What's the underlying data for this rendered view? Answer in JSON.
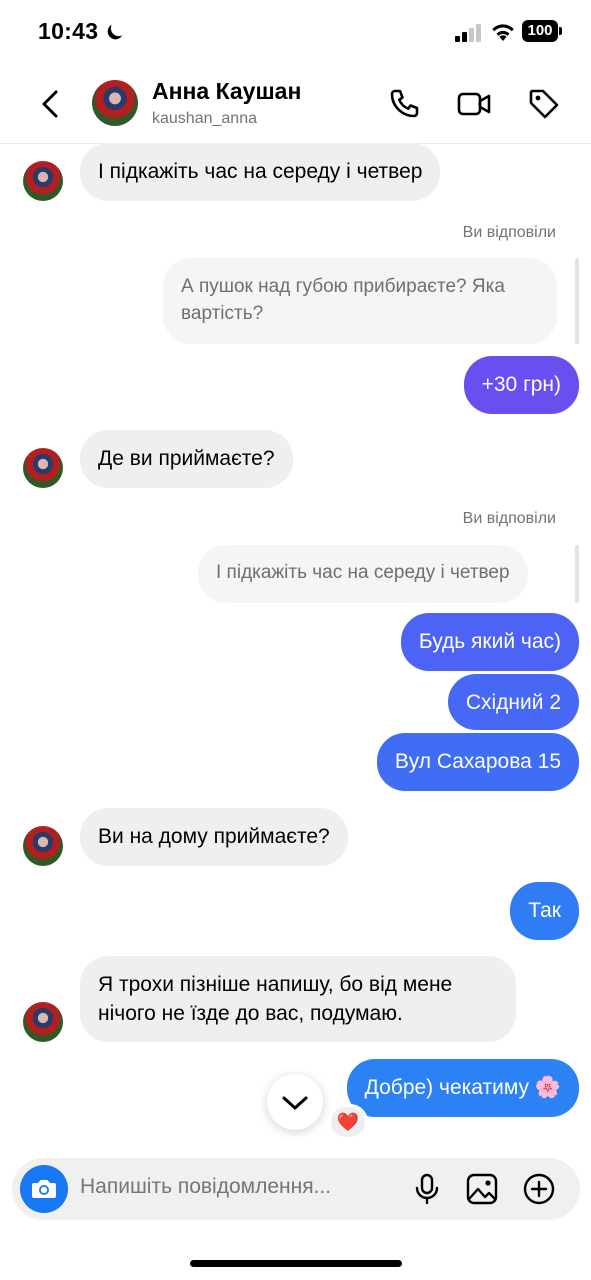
{
  "status_bar": {
    "time": "10:43",
    "battery": "100"
  },
  "header": {
    "name": "Анна Каушан",
    "username": "kaushan_anna"
  },
  "labels": {
    "replied": "Ви відповіли"
  },
  "messages": [
    {
      "text": "І підкажіть час на середу і четвер"
    },
    {
      "reply_quote": "А пушок над губою прибираєте? Яка вартість?"
    },
    {
      "text": "+30 грн)"
    },
    {
      "text": "Де ви приймаєте?"
    },
    {
      "reply_quote": "І підкажіть час на середу і четвер"
    },
    {
      "text": "Будь який час)"
    },
    {
      "text": "Східний 2"
    },
    {
      "text": "Вул Сахарова 15"
    },
    {
      "text": "Ви на дому приймаєте?"
    },
    {
      "text": "Так"
    },
    {
      "text": "Я трохи пізніше напишу, бо від мене нічого не їзде до вас, подумаю."
    },
    {
      "text": "Добре) чекатиму 🌸"
    }
  ],
  "reaction": "❤️",
  "composer": {
    "placeholder": "Напишіть повідомлення..."
  },
  "colors": {
    "in_bubble": "#efefef",
    "out_purple": "#6a4ef0",
    "out_blue": "#2f7cf5",
    "camera": "#1877f2"
  }
}
